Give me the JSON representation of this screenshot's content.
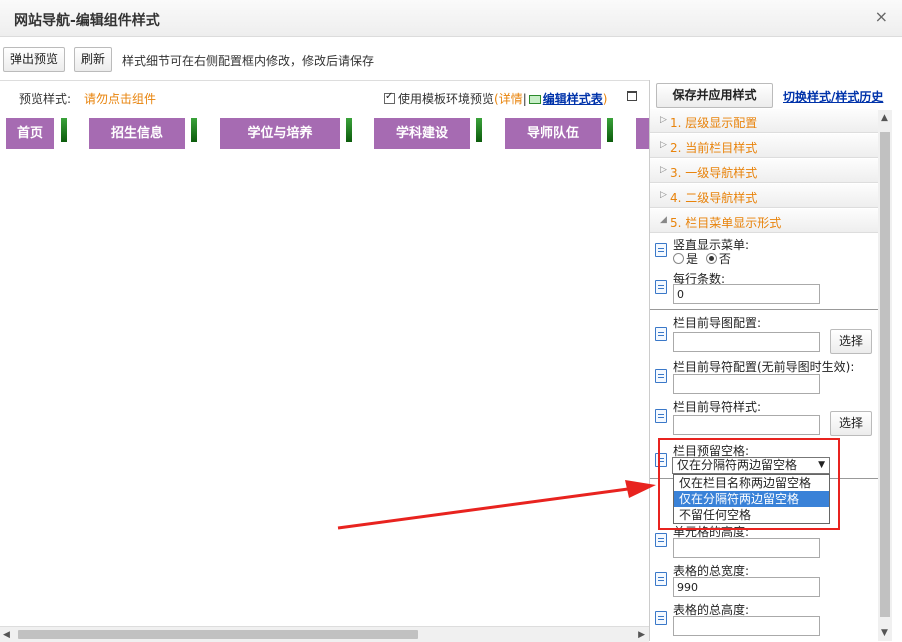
{
  "dialog": {
    "title": "网站导航-编辑组件样式",
    "close_glyph": "×"
  },
  "toolbar": {
    "popup_preview": "弹出预览",
    "refresh": "刷新",
    "hint": "样式细节可在右侧配置框内修改，修改后请保存"
  },
  "preview": {
    "label": "预览样式:",
    "warning": "请勿点击组件",
    "use_template": "使用模板环境预览",
    "details": "(详情",
    "pipe": "|",
    "edit_style_table": "编辑样式表",
    "close_paren": ")",
    "nav_items": [
      "首页",
      "招生信息",
      "学位与培养",
      "学科建设",
      "导师队伍"
    ],
    "colors": {
      "nav_bg": "#a66bb2",
      "separator": "#1e7d1e"
    }
  },
  "panel": {
    "save_apply": "保存并应用样式",
    "switch_history": "切换样式/样式历史",
    "sections": [
      {
        "label": "1.  层级显示配置"
      },
      {
        "label": "2.  当前栏目样式"
      },
      {
        "label": "3.  一级导航样式"
      },
      {
        "label": "4.  二级导航样式"
      },
      {
        "label": "5.  栏目菜单显示形式"
      }
    ],
    "fields": {
      "vertical_menu": {
        "label": "竖直显示菜单:",
        "yes": "是",
        "no": "否",
        "selected": "否"
      },
      "per_row": {
        "label": "每行条数:",
        "value": "0"
      },
      "prefix_image": {
        "label": "栏目前导图配置:",
        "value": "",
        "choose": "选择"
      },
      "prefix_symbol": {
        "label": "栏目前导符配置(无前导图时生效):",
        "value": ""
      },
      "prefix_symbol_style": {
        "label": "栏目前导符样式:",
        "value": "",
        "choose": "选择"
      },
      "reserve_space": {
        "label": "栏目预留空格:",
        "value": "仅在分隔符两边留空格",
        "options": [
          "仅在栏目名称两边留空格",
          "仅在分隔符两边留空格",
          "不留任何空格"
        ],
        "highlighted_index": 1
      },
      "cell_height": {
        "label": "单元格的高度:",
        "value": ""
      },
      "table_width": {
        "label": "表格的总宽度:",
        "value": "990"
      },
      "table_height": {
        "label": "表格的总高度:",
        "value": ""
      }
    }
  },
  "annotation_color": "#e8231f"
}
